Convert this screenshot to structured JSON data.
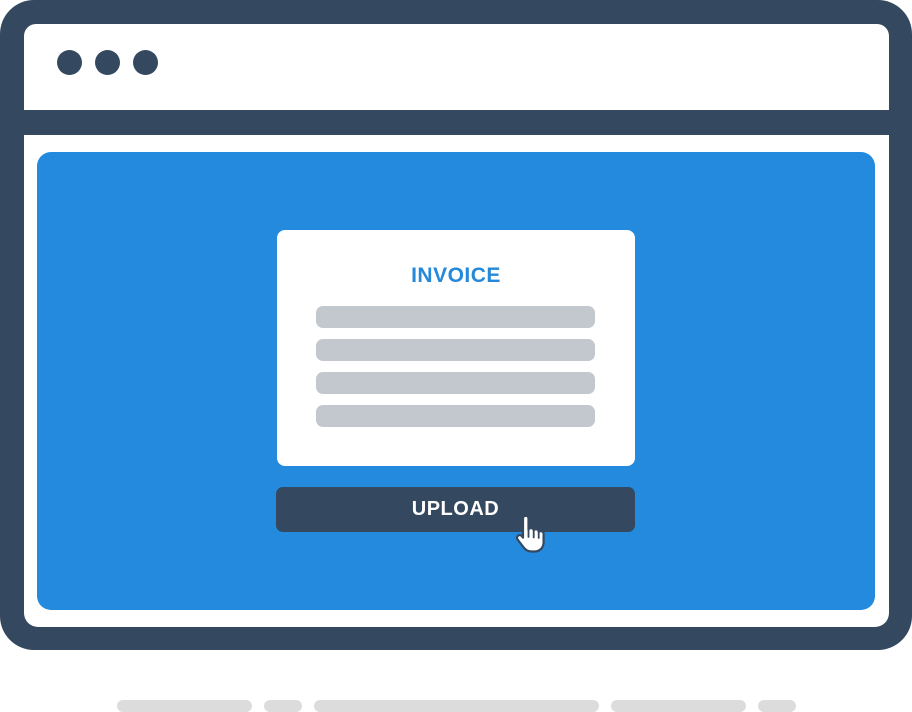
{
  "window": {
    "controls": [
      "window-dot",
      "window-dot",
      "window-dot"
    ]
  },
  "card": {
    "title": "INVOICE",
    "line_count": 4
  },
  "upload": {
    "label": "UPLOAD"
  },
  "cursor": {
    "icon": "hand-pointer-icon"
  },
  "colors": {
    "frame": "#34485f",
    "panel": "#238ade",
    "title": "#2688d8",
    "placeholder_line": "#c3c8cf",
    "footer_placeholder": "#dcdcdc"
  }
}
